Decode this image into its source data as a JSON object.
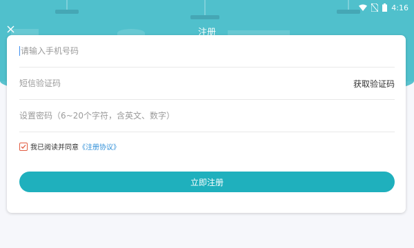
{
  "status_bar": {
    "time": "4:16",
    "icons": [
      "wifi-icon",
      "no-sim-icon",
      "battery-icon"
    ]
  },
  "header": {
    "title": "注册",
    "close_icon": "close-icon"
  },
  "form": {
    "phone": {
      "value": "",
      "placeholder": "请输入手机号码"
    },
    "sms_code": {
      "value": "",
      "placeholder": "短信验证码",
      "button_label": "获取验证码"
    },
    "password": {
      "value": "",
      "placeholder": "设置密码（6~20个字符，含英文、数字）"
    },
    "agreement": {
      "checked": true,
      "text": "我已阅读并同意",
      "link_text": "《注册协议》"
    },
    "submit_label": "立即注册"
  },
  "colors": {
    "header_bg": "#50c0cc",
    "button_bg": "#1fb0bd",
    "link": "#2f8fd8",
    "checkbox": "#e25a3f",
    "page_bg": "#f6f7fb"
  }
}
